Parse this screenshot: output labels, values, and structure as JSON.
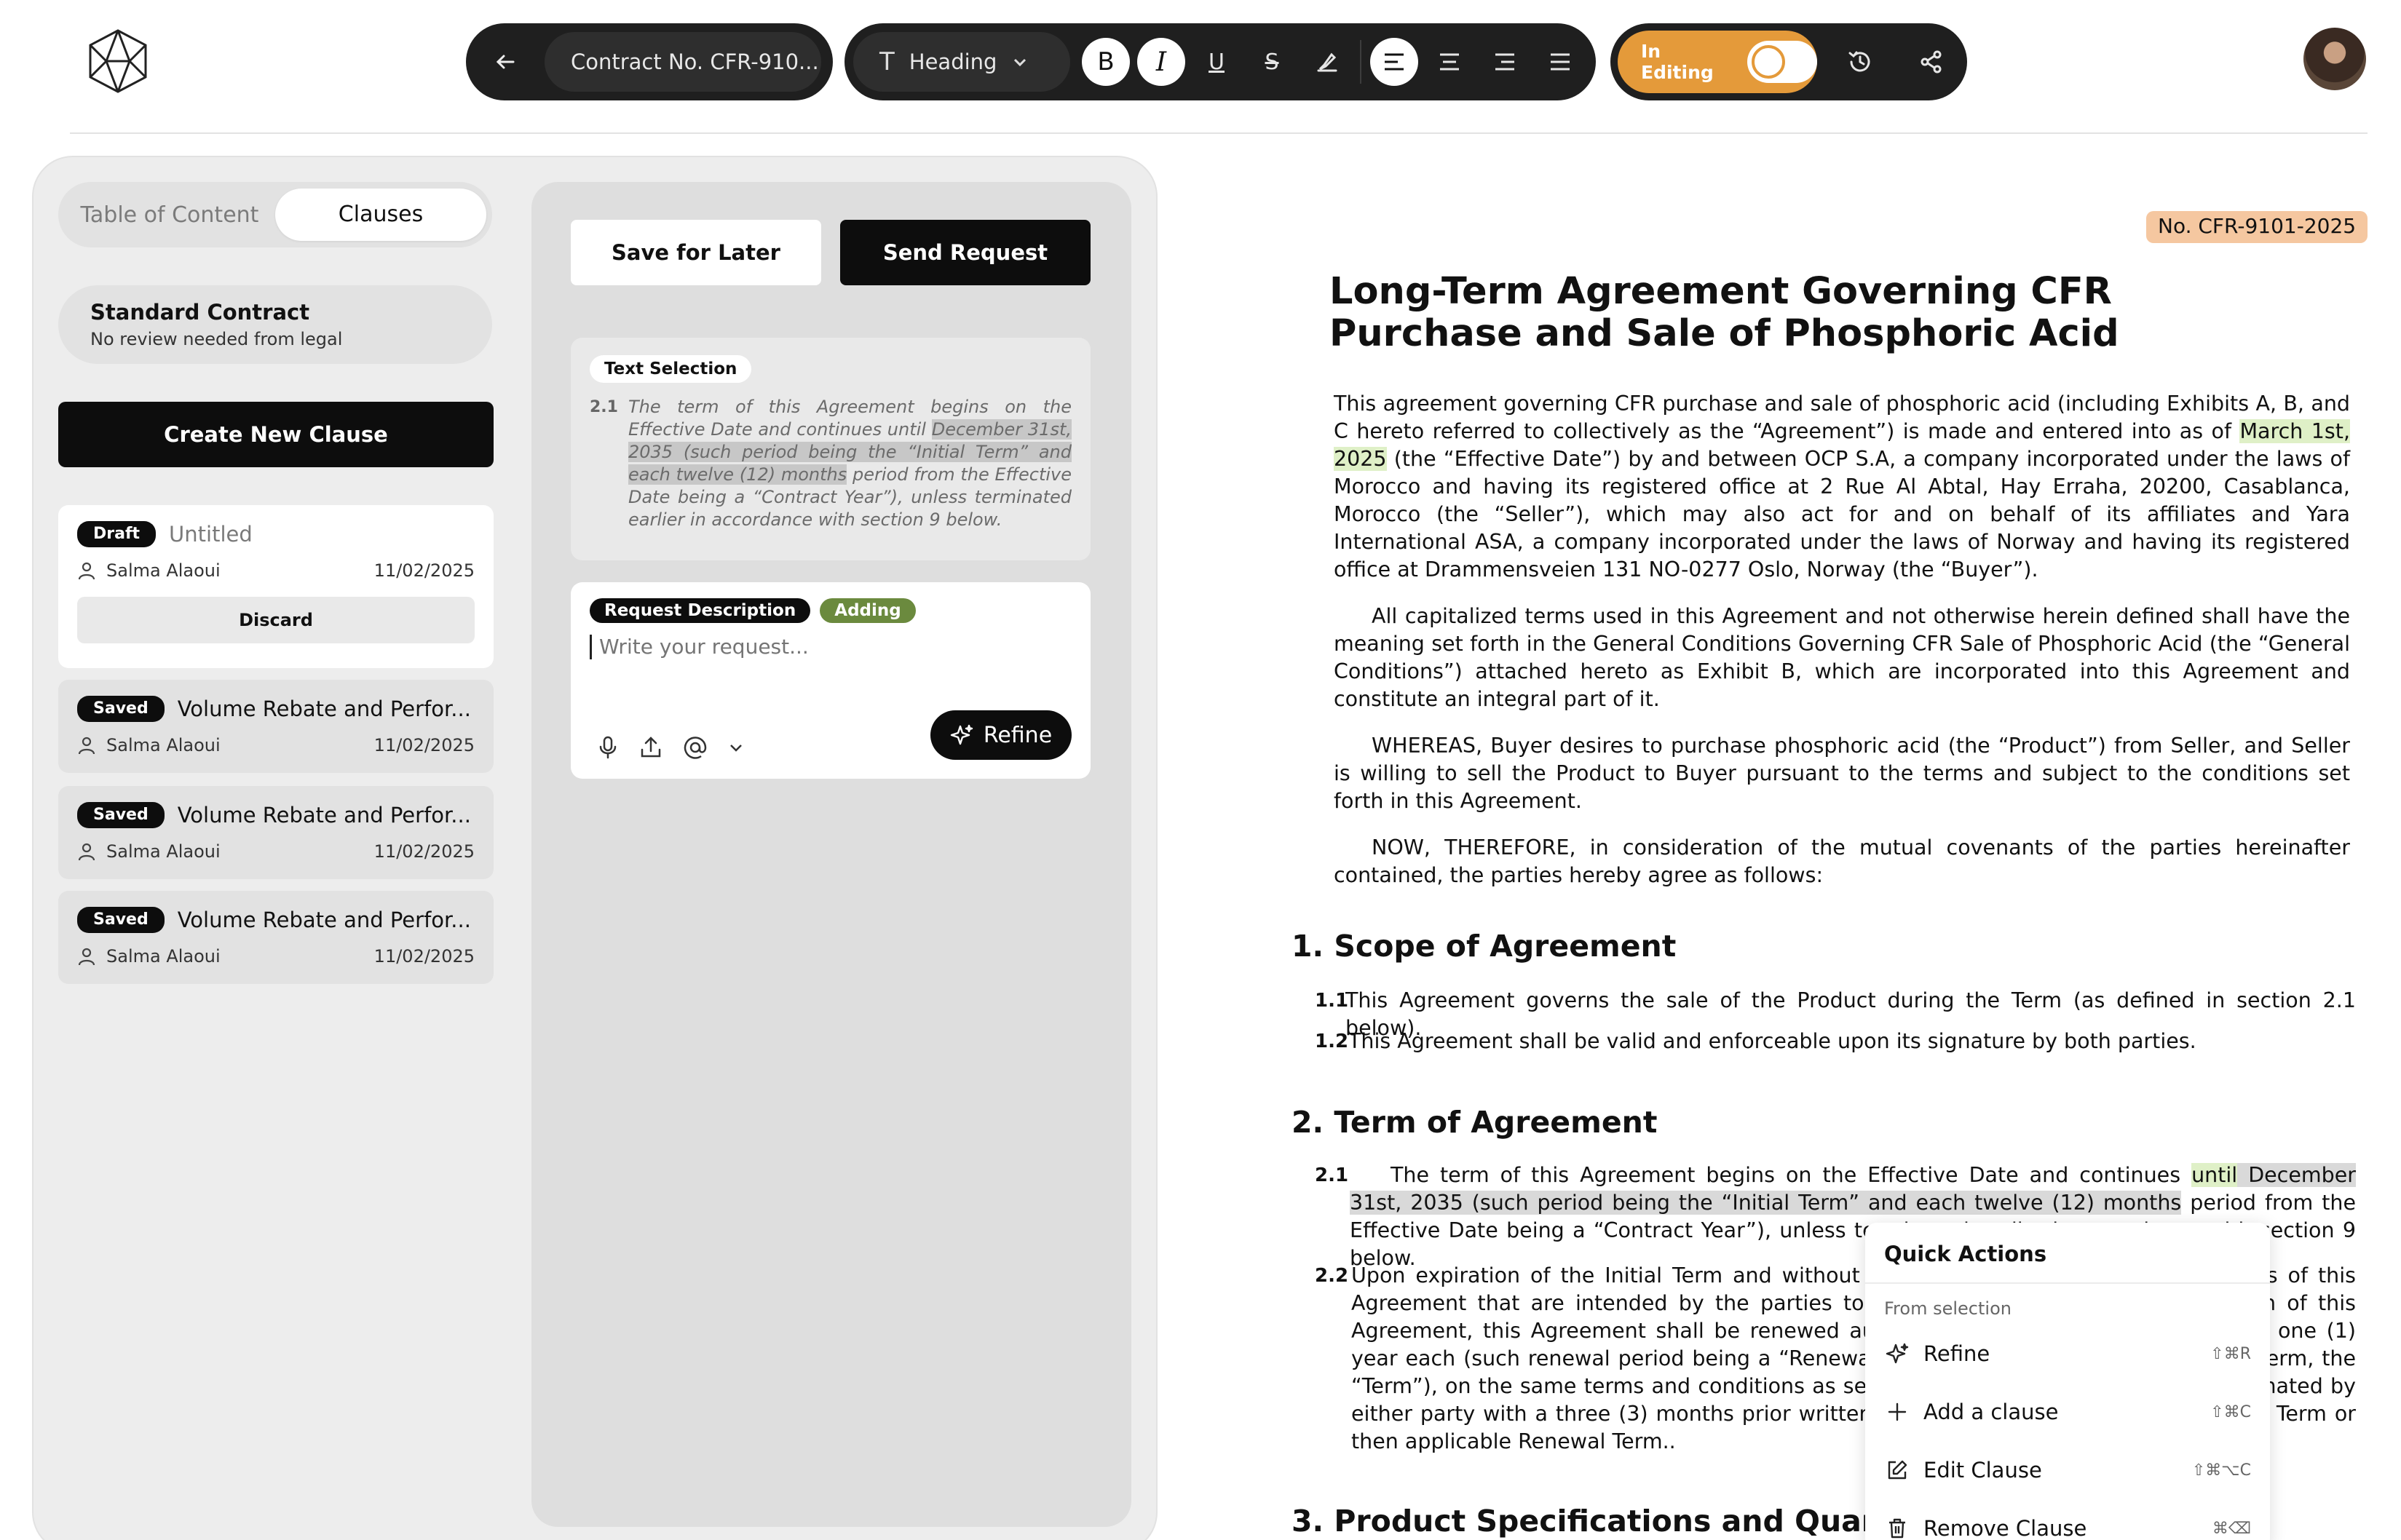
{
  "toolbar": {
    "doc_title": "Contract No. CFR-910...",
    "style_label": "Heading",
    "editing_label": "In Editing",
    "editing_on": true,
    "format_buttons": [
      "bold-icon",
      "italic-icon",
      "underline-icon",
      "strikethrough-icon",
      "highlighter-icon"
    ],
    "align_buttons": [
      "align-left-icon",
      "align-center-icon",
      "align-right-icon",
      "align-justify-icon"
    ]
  },
  "left_panel": {
    "tabs": [
      {
        "label": "Table of Content",
        "active": false
      },
      {
        "label": "Clauses",
        "active": true
      }
    ],
    "contract_type": {
      "title": "Standard Contract",
      "subtitle": "No review needed from legal"
    },
    "create_button": "Create New Clause",
    "clauses": [
      {
        "status": "Draft",
        "title": "Untitled",
        "author": "Salma Alaoui",
        "date": "11/02/2025",
        "action": "Discard"
      },
      {
        "status": "Saved",
        "title": "Volume Rebate and Perfor...",
        "author": "Salma Alaoui",
        "date": "11/02/2025"
      },
      {
        "status": "Saved",
        "title": "Volume Rebate and Perfor...",
        "author": "Salma Alaoui",
        "date": "11/02/2025"
      },
      {
        "status": "Saved",
        "title": "Volume Rebate and Perfor...",
        "author": "Salma Alaoui",
        "date": "11/02/2025"
      }
    ]
  },
  "middle_panel": {
    "save_later": "Save for Later",
    "send_request": "Send Request",
    "text_selection": {
      "label": "Text Selection",
      "number": "2.1",
      "before": "The term of this Agreement begins on the Effective Date and continues until ",
      "highlight": "December 31st, 2035 (such period being the “Initial Term” and each twelve (12) months",
      "after": " period from the Effective Date being a “Contract Year”), unless terminated earlier in accordance with section 9 below."
    },
    "request": {
      "label": "Request Description",
      "status": "Adding",
      "placeholder": "Write your request...",
      "refine": "Refine"
    }
  },
  "document": {
    "number": "No. CFR-9101-2025",
    "title": "Long-Term Agreement Governing CFR Purchase and Sale of Phosphoric Acid",
    "intro_a": "This agreement governing CFR purchase and sale of phosphoric acid (including Exhibits A, B, and C hereto referred to collectively as the “Agreement”) is made and entered into as of ",
    "intro_date": "March 1st, 2025",
    "intro_b": " (the “Effective Date”) by and between OCP S.A, a company incorporated under the laws of Morocco and having its registered office at 2 Rue Al Abtal, Hay Erraha, 20200, Casablanca, Morocco (the “Seller”), which may also act for and on behalf of its affiliates and Yara International ASA, a company incorporated under the laws of Norway and having its registered office at Drammensveien 131 NO-0277 Oslo, Norway (the “Buyer”).",
    "para2": "All capitalized terms used in this Agreement and not otherwise herein defined shall have the meaning set forth in the General Conditions Governing CFR Sale of Phosphoric Acid (the “General Conditions”) attached hereto as Exhibit B, which are incorporated into this Agreement and constitute an integral part of it.",
    "para3": "WHEREAS, Buyer desires to purchase phosphoric acid (the “Product”) from Seller, and Seller is willing to sell the Product to Buyer pursuant to the terms and subject to the conditions set forth in this Agreement.",
    "para4": "NOW, THEREFORE, in consideration of the mutual covenants of the parties hereinafter contained, the parties hereby agree as follows:",
    "s1_title": "1. Scope of Agreement",
    "s1_1_num": "1.1",
    "s1_1": "This Agreement governs the sale of the Product during the Term (as defined in section 2.1 below).",
    "s1_2_num": "1.2",
    "s1_2": "This Agreement shall be valid and enforceable upon its signature by both parties.",
    "s2_title": "2. Term of Agreement",
    "s2_1_num": "2.1",
    "s2_1_a": "The term of this Agreement begins on the Effective Date and continues ",
    "s2_1_until": "until",
    "s2_1_hl": " December 31st, 2035 (such period being the “Initial Term” and each twelve (12) months",
    "s2_1_b": " period from the Effective Date being a “Contract Year”), unless terminated earlier in accordance with section 9 below.",
    "s2_2_num": "2.2",
    "s2_2": "Upon expiration of the Initial Term and without prejudice to the terms and conditions of this Agreement that are intended by the parties to survive the expiration or termination of this Agreement, this Agreement shall be renewed automatically for successive periods of one (1) year each (such renewal period being a “Renewal Term” and together with the Initial Term, the “Term”), on the same terms and conditions as set forth in this Agreement unless terminated by either party with a three (3) months prior written notice before the expiry of the Initial Term or then applicable Renewal Term..",
    "s3_title": "3. Product Specifications and Quantity"
  },
  "quick_actions": {
    "title": "Quick Actions",
    "subtitle": "From selection",
    "items": [
      {
        "label": "Refine",
        "shortcut": "⇧⌘R",
        "icon": "sparkle-icon"
      },
      {
        "label": "Add a clause",
        "shortcut": "⇧⌘C",
        "icon": "plus-icon"
      },
      {
        "label": "Edit Clause",
        "shortcut": "⇧⌘⌥C",
        "icon": "edit-icon"
      },
      {
        "label": "Remove Clause",
        "shortcut": "⌘⌫",
        "icon": "trash-icon"
      }
    ]
  },
  "colors": {
    "accent_orange": "#e49a3a",
    "highlight_green": "#dff0c7",
    "doc_number_bg": "#f5c7a0",
    "adding_green": "#6b8a3e"
  }
}
